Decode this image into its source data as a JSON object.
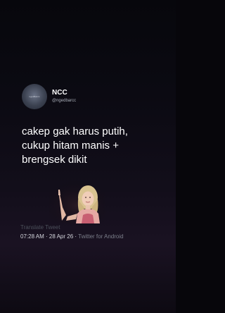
{
  "tweet": {
    "author": {
      "avatar_text": "ngedbarcc",
      "display_name": "NCC",
      "handle": "@ngedbarcc"
    },
    "text_lines": [
      "cakep gak harus putih,",
      "cukup hitam manis +",
      "brengsek dikit"
    ],
    "media": {
      "description_icon": "pointing-woman-image"
    },
    "translate_label": "Translate Tweet",
    "timestamp": "07:28 AM · 28 Apr 26 · ",
    "source": "Twitter for Android"
  },
  "colors": {
    "background": "#07060b",
    "text_primary": "#ffffff",
    "text_secondary": "#a9adb8",
    "translate_link": "#4b4f5a",
    "source_link": "#7b7f8a"
  }
}
